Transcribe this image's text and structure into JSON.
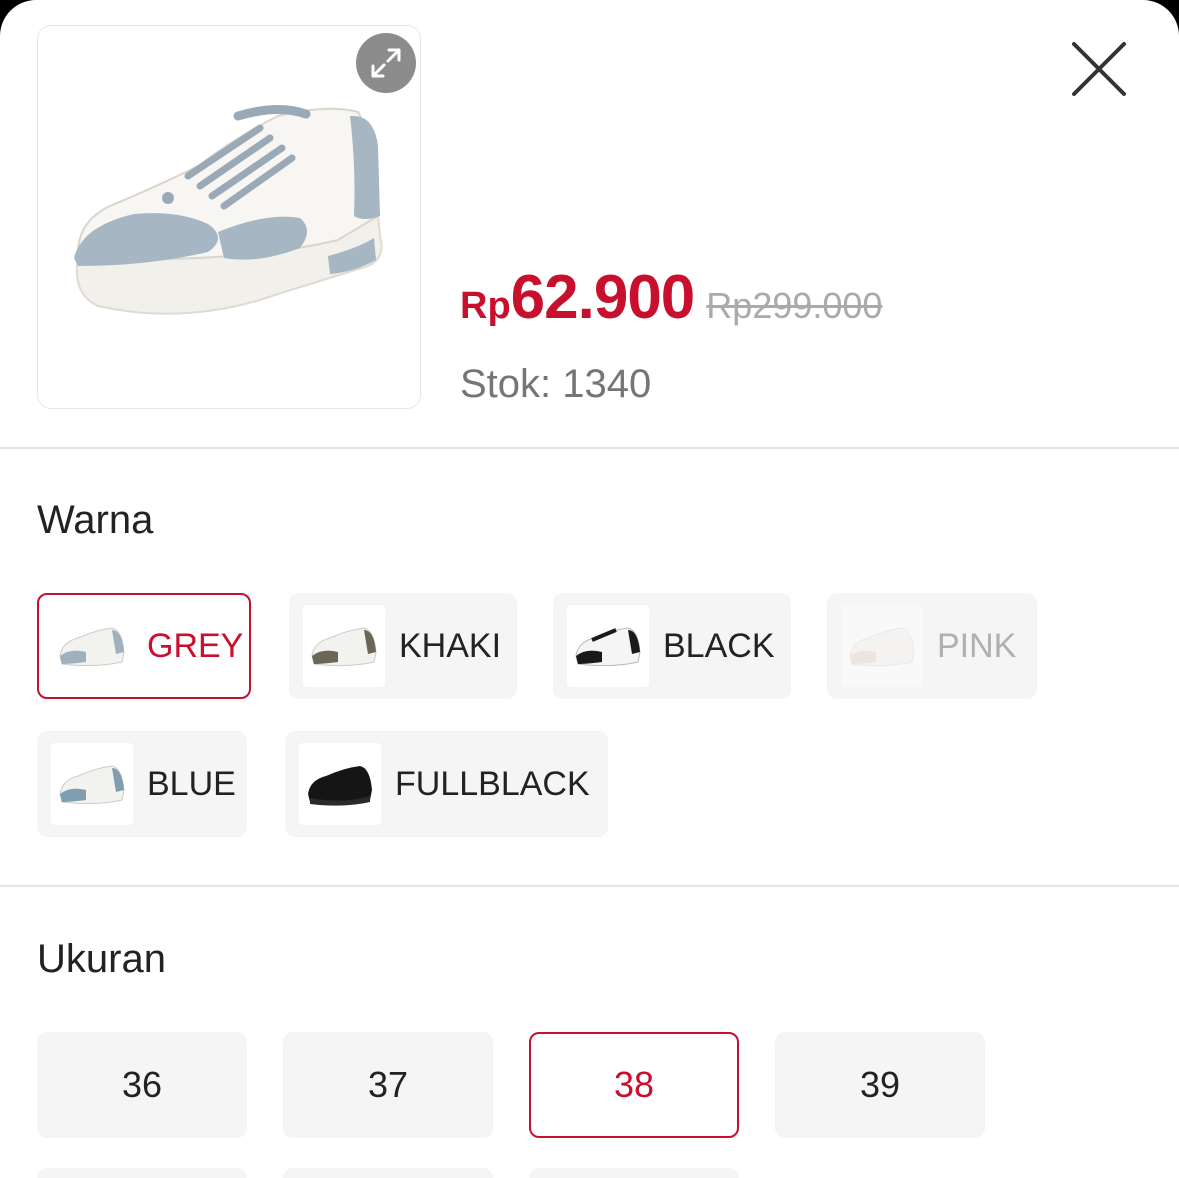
{
  "product": {
    "price_currency": "Rp",
    "price_amount": "62.900",
    "original_price": "Rp299.000",
    "stock": "Stok: 1340"
  },
  "variants": {
    "color_title": "Warna",
    "colors": [
      {
        "label": "GREY",
        "state": "selected",
        "accent": "#9fb0bf"
      },
      {
        "label": "KHAKI",
        "state": "normal",
        "accent": "#6b6656"
      },
      {
        "label": "BLACK",
        "state": "normal",
        "accent": "#1a1a1a"
      },
      {
        "label": "PINK",
        "state": "disabled",
        "accent": "#e8cfc9"
      },
      {
        "label": "BLUE",
        "state": "normal",
        "accent": "#7f9fb0"
      },
      {
        "label": "FULLBLACK",
        "state": "normal",
        "accent": "#151515"
      }
    ],
    "size_title": "Ukuran",
    "sizes": [
      {
        "label": "36",
        "state": "normal"
      },
      {
        "label": "37",
        "state": "normal"
      },
      {
        "label": "38",
        "state": "selected"
      },
      {
        "label": "39",
        "state": "normal"
      }
    ]
  },
  "icons": {
    "expand": "expand-icon",
    "close": "close-icon"
  },
  "colors": {
    "accent_red": "#c8102e",
    "chip_bg": "#f5f5f5"
  }
}
